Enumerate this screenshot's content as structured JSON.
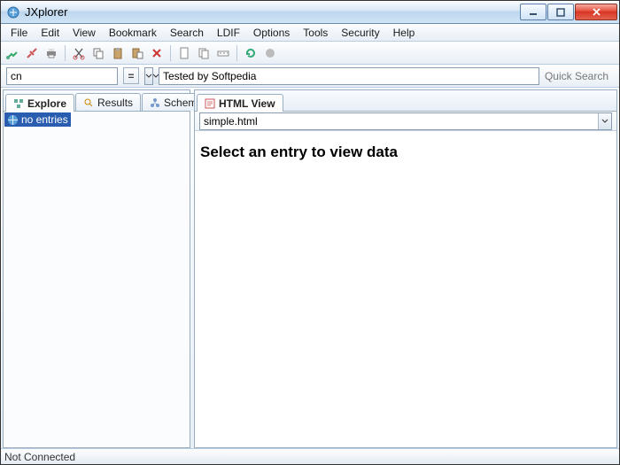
{
  "window": {
    "title": "JXplorer"
  },
  "menu": [
    "File",
    "Edit",
    "View",
    "Bookmark",
    "Search",
    "LDIF",
    "Options",
    "Tools",
    "Security",
    "Help"
  ],
  "toolbar_icons": [
    "connect",
    "disconnect",
    "print",
    "cut",
    "copy",
    "paste",
    "paste2",
    "delete",
    "new",
    "rename",
    "refresh",
    "stop"
  ],
  "search": {
    "attr_value": "cn",
    "filter_value": "Tested by Softpedia",
    "quick_label": "Quick Search",
    "eq_label": "="
  },
  "left": {
    "tabs": [
      {
        "label": "Explore",
        "icon": "tree-icon",
        "active": true
      },
      {
        "label": "Results",
        "icon": "results-icon",
        "active": false
      },
      {
        "label": "Schema",
        "icon": "schema-icon",
        "active": false
      }
    ],
    "tree_root": "no entries"
  },
  "right": {
    "tabs": [
      {
        "label": "HTML View",
        "icon": "html-icon",
        "active": true
      }
    ],
    "template_value": "simple.html",
    "content_text": "Select an entry to view data"
  },
  "status": "Not Connected"
}
